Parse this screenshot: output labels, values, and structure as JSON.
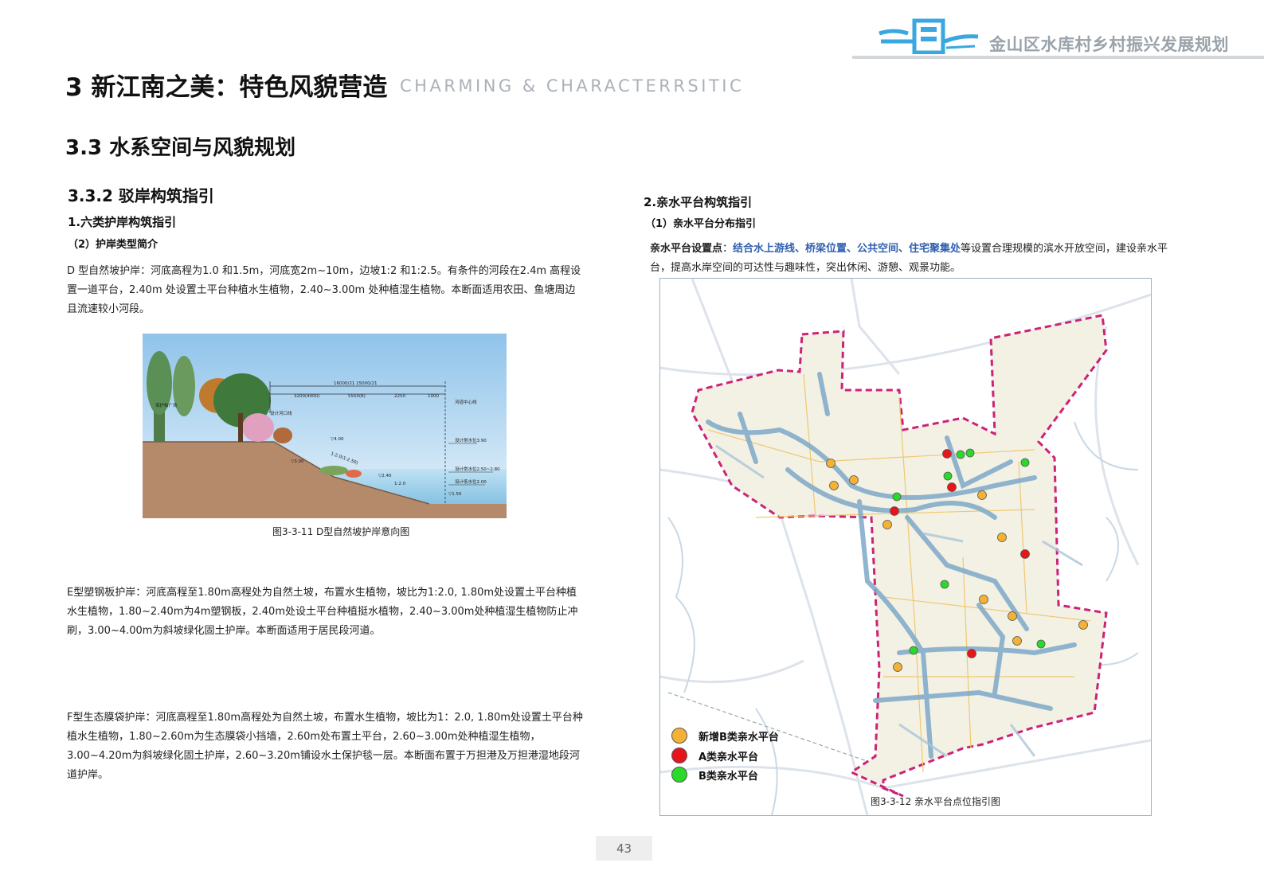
{
  "header": {
    "doc_title": "金山区水库村乡村振兴发展规划",
    "logo_icon": "water-village-logo-icon",
    "accent_color": "#3aa7e0"
  },
  "chapter": {
    "title": "3 新江南之美：特色风貌营造",
    "title_en": "CHARMING & CHARACTERRSITIC"
  },
  "section": {
    "title": "3.3 水系空间与风貌规划",
    "subsection": "3.3.2 驳岸构筑指引"
  },
  "left": {
    "heading1": "1.六类护岸构筑指引",
    "heading2": "（2）护岸类型简介",
    "para_d": "D 型自然坡护岸：河底高程为1.0 和1.5m，河底宽2m~10m，边坡1:2 和1:2.5。有条件的河段在2.4m 高程设置一道平台，2.40m 处设置土平台种植水生植物，2.40~3.00m 处种植湿生植物。本断面适用农田、鱼塘周边且流速较小河段。",
    "figure_d_caption": "图3-3-11 D型自然坡护岸意向图",
    "figure_d_labels": {
      "dim_total": "16000/21 15000/21",
      "dim_a": "3200(4000)",
      "dim_b": "5550(8)",
      "dim_c": "2250",
      "dim_d": "1000",
      "lbl_left": "保护柏广场",
      "lbl_mid": "设计河口线",
      "lbl_right": "河道中心线",
      "lv_400": "▽4.00",
      "slope": "1:2.0(1:2.50)",
      "lv_300": "▽3.00",
      "lv_240": "▽2.40",
      "lv_150": "▽1.50",
      "water_390": "设计常水位3.90",
      "water_250": "设计常水位2.50~2.80",
      "water_200": "设计低水位2.00",
      "lv_bottom": "▽1.50",
      "slope_small": "1:2.0"
    },
    "para_e": "E型塑钢板护岸：河底高程至1.80m高程处为自然土坡，布置水生植物，坡比为1:2.0, 1.80m处设置土平台种植水生植物，1.80~2.40m为4m塑钢板，2.40m处设土平台种植挺水植物，2.40~3.00m处种植湿生植物防止冲刷，3.00~4.00m为斜坡绿化固土护岸。本断面适用于居民段河道。",
    "para_f": "F型生态膜袋护岸：河底高程至1.80m高程处为自然土坡，布置水生植物，坡比为1：2.0, 1.80m处设置土平台种植水生植物，1.80~2.60m为生态膜袋小挡墙，2.60m处布置土平台，2.60~3.00m处种植湿生植物，3.00~4.20m为斜坡绿化固土护岸，2.60~3.20m铺设水土保护毯一层。本断面布置于万担港及万担港湿地段河道护岸。"
  },
  "right": {
    "heading1": "2.亲水平台构筑指引",
    "heading2": "（1）亲水平台分布指引",
    "para_lead": "亲水平台设置点",
    "para_colon": "：",
    "para_hl": "结合水上游线、桥梁位置、公共空间、住宅聚集处",
    "para_rest": "等设置合理规模的滨水开放空间，建设亲水平台，提高水岸空间的可达性与趣味性，突出休闲、游憩、观景功能。",
    "map_caption": "图3-3-12 亲水平台点位指引图",
    "legend": [
      {
        "label": "新增B类亲水平台",
        "color": "#f5b133"
      },
      {
        "label": "A类亲水平台",
        "color": "#e8141c"
      },
      {
        "label": "B类亲水平台",
        "color": "#2ad92a"
      }
    ]
  },
  "page_number": "43"
}
